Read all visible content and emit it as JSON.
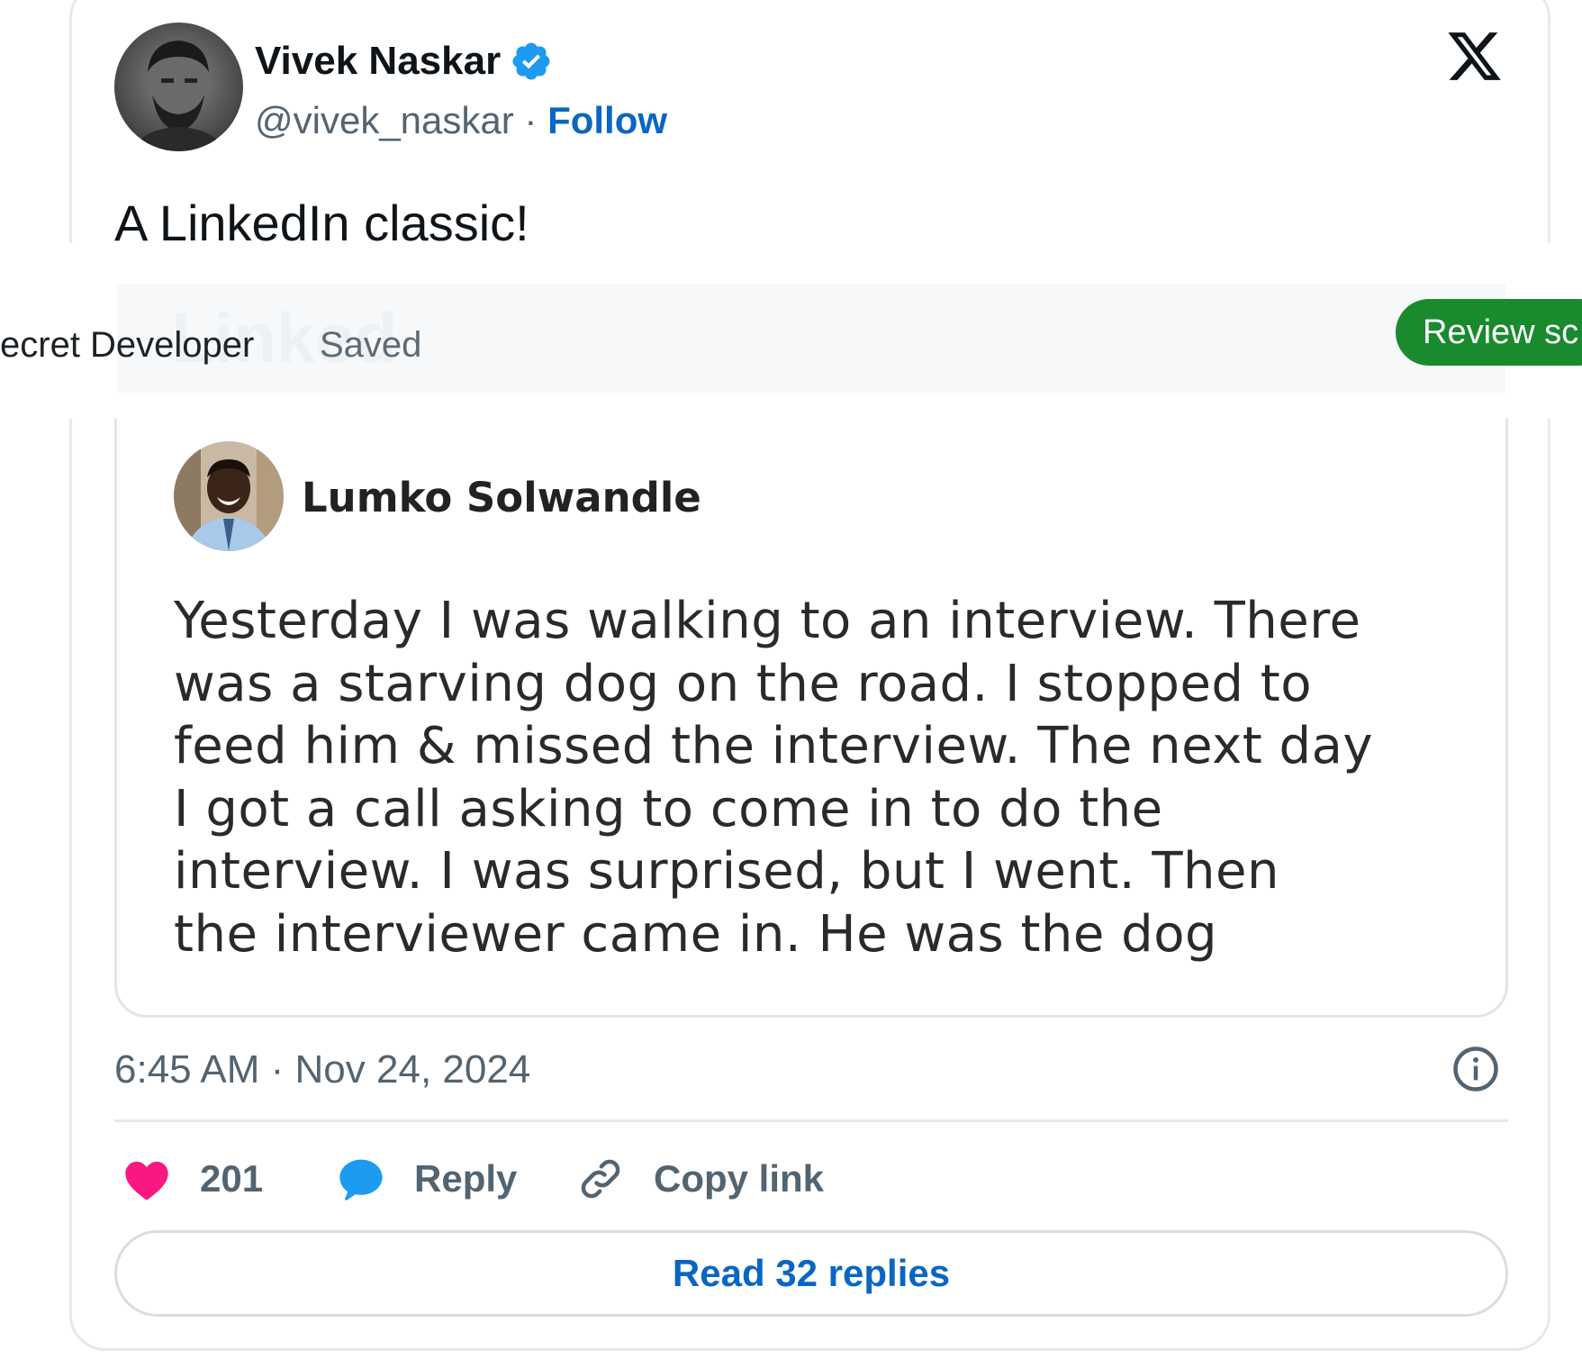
{
  "tweet": {
    "author": {
      "name": "Vivek Naskar",
      "handle": "@vivek_naskar",
      "separator": " · ",
      "follow_label": "Follow",
      "avatar_icon": "avatar-photo",
      "verified_icon": "verified-badge-icon"
    },
    "platform_icon": "x-logo-icon",
    "text": "A LinkedIn classic!",
    "timestamp": "6:45 AM · Nov 24, 2024",
    "info_icon": "info-icon"
  },
  "overlay": {
    "breadcrumb": "ecret Developer",
    "status": "Saved",
    "faint_brand": "Linked",
    "action_button": "Review sc"
  },
  "embedded_post": {
    "author_name": "Lumko Solwandle",
    "lines": [
      "Yesterday I was walking to an interview. There",
      "was a starving dog on the road. I stopped to",
      "feed him & missed the interview. The next day",
      "I got a call asking to come in to do the",
      "interview. I was surprised, but I went. Then",
      "the interviewer came in. He was the dog"
    ]
  },
  "actions": {
    "like_count": "201",
    "reply_label": "Reply",
    "copy_label": "Copy link",
    "read_replies_label": "Read 32 replies"
  },
  "colors": {
    "follow_blue": "#0a66c2",
    "verified_blue": "#1d9bf0",
    "like_pink": "#f91880",
    "reply_blue": "#1d9bf0",
    "review_green": "#1a8a2e",
    "muted_text": "#536471"
  }
}
